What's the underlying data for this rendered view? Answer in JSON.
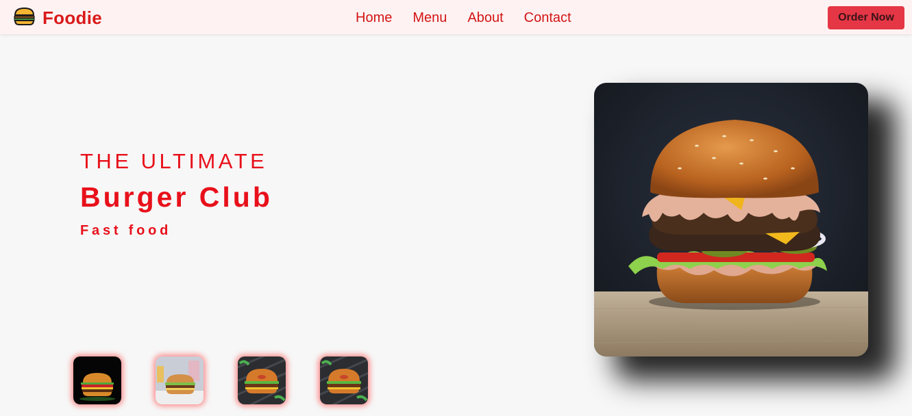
{
  "brand": {
    "name": "Foodie",
    "icon": "burger-icon"
  },
  "nav": {
    "links": [
      {
        "label": "Home"
      },
      {
        "label": "Menu"
      },
      {
        "label": "About"
      },
      {
        "label": "Contact"
      }
    ],
    "cta_label": "Order Now"
  },
  "hero": {
    "eyebrow": "THE ULTIMATE",
    "title": "Burger Club",
    "subtitle": "Fast food",
    "image": "burger-photo"
  },
  "thumbnails": [
    {
      "image": "burger-on-black-photo"
    },
    {
      "image": "burger-with-fries-photo"
    },
    {
      "image": "burger-on-grill-photo"
    },
    {
      "image": "burger-on-grill-photo"
    }
  ],
  "colors": {
    "accent": "#e8101a",
    "nav_bg": "#fff2f2",
    "button_bg": "#e53645",
    "page_bg": "#f7f7f7"
  }
}
